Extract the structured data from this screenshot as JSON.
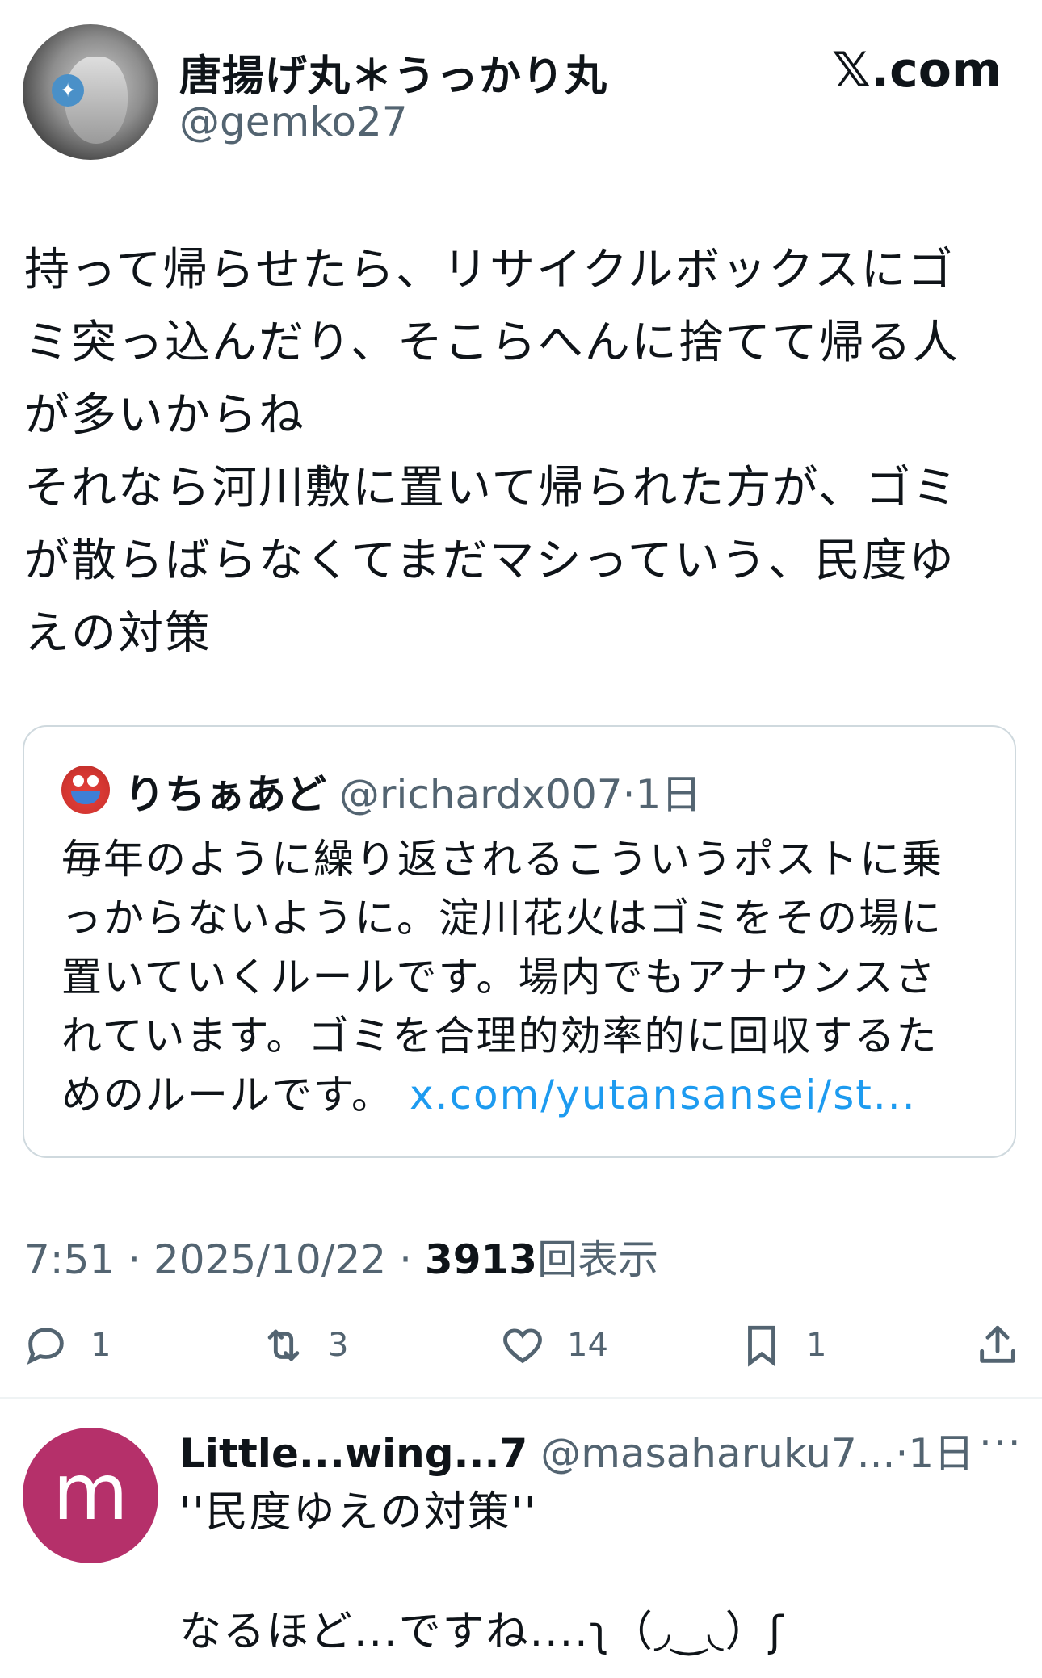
{
  "post": {
    "author_name": "唐揚げ丸＊うっかり丸",
    "author_handle": "@gemko27",
    "brand": "𝕏.com",
    "text": "持って帰らせたら、リサイクルボックスにゴ\nミ突っ込んだり、そこらへんに捨てて帰る人\nが多いからね\nそれなら河川敷に置いて帰られた方が、ゴミ\nが散らばらなくてまだマシっていう、民度ゆ\nえの対策",
    "time": "7:51",
    "date": "2025/10/22",
    "views_count": "3913",
    "views_label": "回表示",
    "sep": "·"
  },
  "quote": {
    "author_name": "りちぁあど",
    "author_handle": "@richardx007",
    "age": "1日",
    "sep": "·",
    "text_lines": [
      "毎年のように繰り返されるこういうポストに乗",
      "っからないように。淀川花火はゴミをその場に",
      "置いていくルールです。場内でもアナウンスさ",
      "れています。ゴミを合理的効率的に回収するた",
      "めのルールです。"
    ],
    "link": "x.com/yutansansei/st..."
  },
  "actions": {
    "reply_count": "1",
    "repost_count": "3",
    "like_count": "14",
    "bookmark_count": "1"
  },
  "reply": {
    "avatar_letter": "m",
    "author_name": "Little...wing...7",
    "author_handle": "@masaharuku7...",
    "sep": "·",
    "age": "1日",
    "more": "···",
    "text": "''民度ゆえの対策''\n\nなるほど...ですね....ʅ（◞‿◟）ʃ"
  },
  "colors": {
    "text": "#0f1419",
    "secondary": "#536471",
    "link": "#1d9bf0",
    "reply_avatar": "#b5306a",
    "border": "#cfd9de"
  }
}
